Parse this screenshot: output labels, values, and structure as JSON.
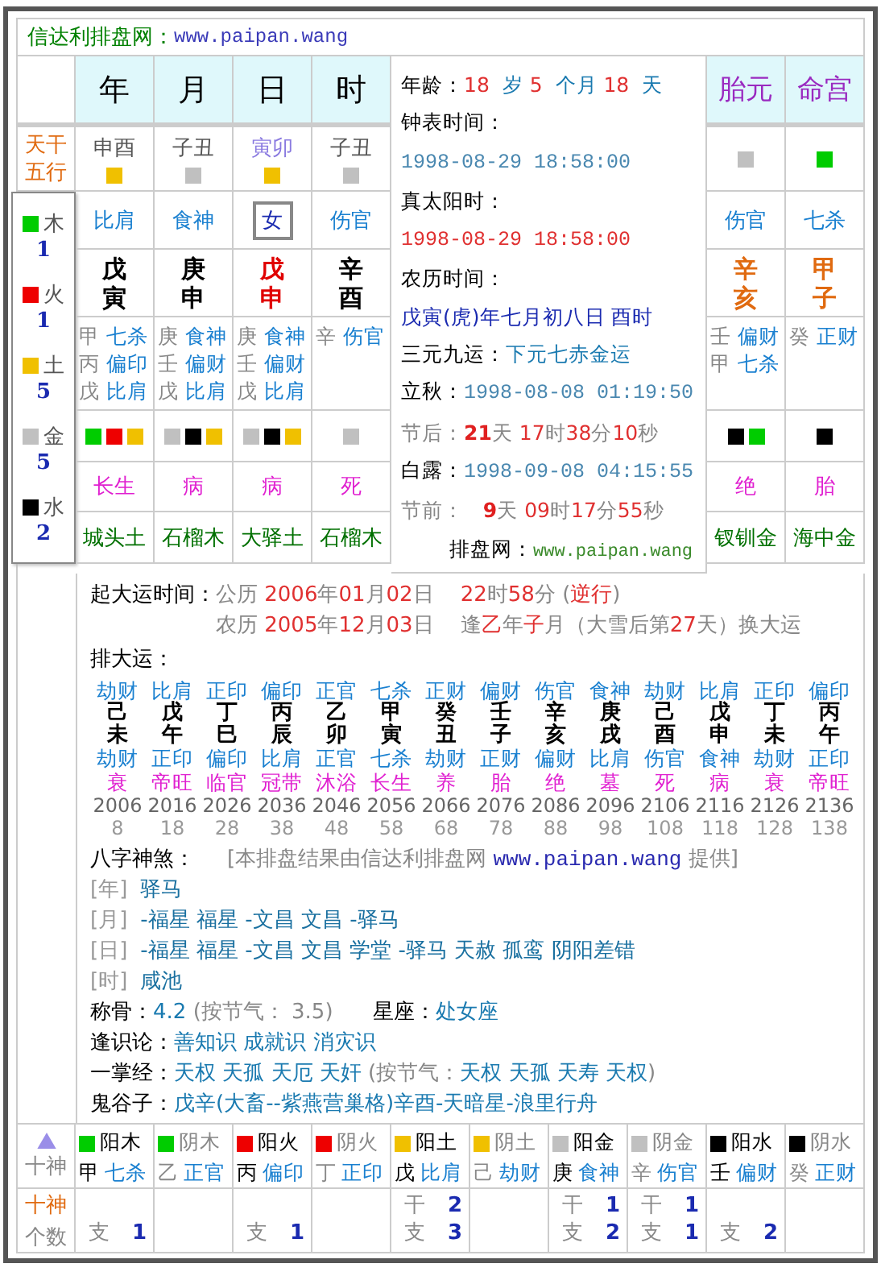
{
  "site": {
    "name": "信达利排盘网：",
    "url": "www.paipan.wang"
  },
  "row_label": "天干五行",
  "pillars": [
    {
      "title": "年",
      "void": "申酉",
      "highlight": false,
      "marks": [
        {
          "color": "#f0c000"
        }
      ],
      "god": {
        "kind": "god",
        "text": "比肩"
      },
      "stem": "戊",
      "branch": "寅",
      "hidden": [
        {
          "stem": "甲",
          "god": "七杀"
        },
        {
          "stem": "丙",
          "god": "偏印"
        },
        {
          "stem": "戊",
          "god": "比肩"
        }
      ],
      "elements": [
        {
          "color": "#00cc00"
        },
        {
          "color": "#ee0000"
        },
        {
          "color": "#f0c000"
        }
      ],
      "stage": "长生",
      "nayin": "城头土"
    },
    {
      "title": "月",
      "void": "子丑",
      "highlight": false,
      "marks": [
        {
          "color": "#c0c0c0"
        }
      ],
      "god": {
        "kind": "god",
        "text": "食神"
      },
      "stem": "庚",
      "branch": "申",
      "hidden": [
        {
          "stem": "庚",
          "god": "食神"
        },
        {
          "stem": "壬",
          "god": "偏财"
        },
        {
          "stem": "戊",
          "god": "比肩"
        }
      ],
      "elements": [
        {
          "color": "#c0c0c0"
        },
        {
          "color": "#000000"
        },
        {
          "color": "#f0c000"
        }
      ],
      "stage": "病",
      "nayin": "石榴木"
    },
    {
      "title": "日",
      "void": "寅卯",
      "highlight": true,
      "marks": [
        {
          "color": "#f0c000"
        }
      ],
      "god": {
        "kind": "gender",
        "text": "女"
      },
      "stem": "戊",
      "branch": "申",
      "hidden": [
        {
          "stem": "庚",
          "god": "食神"
        },
        {
          "stem": "壬",
          "god": "偏财"
        },
        {
          "stem": "戊",
          "god": "比肩"
        }
      ],
      "elements": [
        {
          "color": "#c0c0c0"
        },
        {
          "color": "#000000"
        },
        {
          "color": "#f0c000"
        }
      ],
      "stage": "病",
      "nayin": "大驿土"
    },
    {
      "title": "时",
      "void": "子丑",
      "highlight": false,
      "marks": [
        {
          "color": "#c0c0c0"
        }
      ],
      "god": {
        "kind": "god",
        "text": "伤官"
      },
      "stem": "辛",
      "branch": "酉",
      "hidden": [
        {
          "stem": "辛",
          "god": "伤官"
        }
      ],
      "elements": [
        {
          "color": "#c0c0c0"
        }
      ],
      "stage": "死",
      "nayin": "石榴木"
    }
  ],
  "extras": [
    {
      "title": "胎元",
      "marks": [
        {
          "color": "#c0c0c0"
        }
      ],
      "god": {
        "kind": "god",
        "text": "伤官"
      },
      "stem": "辛",
      "branch": "亥",
      "hidden": [
        {
          "stem": "壬",
          "god": "偏财"
        },
        {
          "stem": "甲",
          "god": "七杀"
        }
      ],
      "elements": [
        {
          "color": "#000000"
        },
        {
          "color": "#00cc00"
        }
      ],
      "stage": "绝",
      "nayin": "钗钏金"
    },
    {
      "title": "命宫",
      "marks": [
        {
          "color": "#00cc00"
        }
      ],
      "god": {
        "kind": "god",
        "text": "七杀"
      },
      "stem": "甲",
      "branch": "子",
      "hidden": [
        {
          "stem": "癸",
          "god": "正财"
        }
      ],
      "elements": [
        {
          "color": "#000000"
        }
      ],
      "stage": "胎",
      "nayin": "海中金"
    }
  ],
  "legend": [
    {
      "name": "木",
      "color": "#00cc00",
      "count": "1"
    },
    {
      "name": "火",
      "color": "#ee0000",
      "count": "1"
    },
    {
      "name": "土",
      "color": "#f0c000",
      "count": "5"
    },
    {
      "name": "金",
      "color": "#c0c0c0",
      "count": "5"
    },
    {
      "name": "水",
      "color": "#000000",
      "count": "2"
    }
  ],
  "info": {
    "lines": [
      [
        {
          "kind": "label",
          "text": "年龄："
        },
        {
          "kind": "num",
          "text": "18 "
        },
        {
          "kind": "value",
          "text": " 岁 "
        },
        {
          "kind": "num",
          "text": "5 "
        },
        {
          "kind": "value",
          "text": " 个月 "
        },
        {
          "kind": "num",
          "text": "18 "
        },
        {
          "kind": "value",
          "text": " 天"
        }
      ],
      [
        {
          "kind": "label",
          "text": "钟表时间："
        }
      ],
      [
        {
          "kind": "date",
          "text": "1998-08-29 18:58:00"
        }
      ],
      [
        {
          "kind": "label",
          "text": "真太阳时："
        }
      ],
      [
        {
          "kind": "date_red",
          "text": "1998-08-29 18:58:00"
        }
      ],
      [
        {
          "kind": "label",
          "text": "农历时间："
        }
      ],
      [
        {
          "kind": "lunar",
          "text": "戊寅(虎)年七月初八日 酉时"
        }
      ],
      [
        {
          "kind": "label",
          "text": "三元九运："
        },
        {
          "kind": "value",
          "text": "下元七赤金运"
        }
      ],
      [
        {
          "kind": "label",
          "text": "立秋："
        },
        {
          "kind": "date",
          "text": "1998-08-08 01:19:50"
        }
      ],
      [
        {
          "kind": "muted",
          "text": "节后："
        },
        {
          "kind": "num_bold",
          "text": "21"
        },
        {
          "kind": "muted",
          "text": "天 "
        },
        {
          "kind": "num",
          "text": "17"
        },
        {
          "kind": "muted",
          "text": "时"
        },
        {
          "kind": "num",
          "text": "38"
        },
        {
          "kind": "muted",
          "text": "分"
        },
        {
          "kind": "num",
          "text": "10"
        },
        {
          "kind": "muted",
          "text": "秒"
        }
      ],
      [
        {
          "kind": "label",
          "text": "白露："
        },
        {
          "kind": "date",
          "text": "1998-09-08 04:15:55"
        }
      ],
      [
        {
          "kind": "muted",
          "text": "节前：   "
        },
        {
          "kind": "num_bold",
          "text": "9"
        },
        {
          "kind": "muted",
          "text": "天 "
        },
        {
          "kind": "num",
          "text": "09"
        },
        {
          "kind": "muted",
          "text": "时"
        },
        {
          "kind": "num",
          "text": "17"
        },
        {
          "kind": "muted",
          "text": "分"
        },
        {
          "kind": "num",
          "text": "55"
        },
        {
          "kind": "muted",
          "text": "秒"
        }
      ]
    ],
    "footer": [
      {
        "kind": "label",
        "text": "排盘网："
      },
      {
        "kind": "link",
        "text": "www.paipan.wang"
      }
    ]
  },
  "qiyun": {
    "label": "起大运时间：",
    "lines": [
      [
        {
          "kind": "muted",
          "text": "公历 "
        },
        {
          "kind": "num",
          "text": "2006"
        },
        {
          "kind": "muted",
          "text": "年"
        },
        {
          "kind": "num",
          "text": "01"
        },
        {
          "kind": "muted",
          "text": "月"
        },
        {
          "kind": "num",
          "text": "02"
        },
        {
          "kind": "muted",
          "text": "日    "
        },
        {
          "kind": "num",
          "text": "22"
        },
        {
          "kind": "muted",
          "text": "时"
        },
        {
          "kind": "num",
          "text": "58"
        },
        {
          "kind": "muted",
          "text": "分 ("
        },
        {
          "kind": "num",
          "text": "逆行"
        },
        {
          "kind": "muted",
          "text": ")"
        }
      ],
      [
        {
          "kind": "muted",
          "text": "农历 "
        },
        {
          "kind": "num",
          "text": "2005"
        },
        {
          "kind": "muted",
          "text": "年"
        },
        {
          "kind": "num",
          "text": "12"
        },
        {
          "kind": "muted",
          "text": "月"
        },
        {
          "kind": "num",
          "text": "03"
        },
        {
          "kind": "muted",
          "text": "日    逢"
        },
        {
          "kind": "num",
          "text": "乙"
        },
        {
          "kind": "muted",
          "text": "年"
        },
        {
          "kind": "num",
          "text": "子"
        },
        {
          "kind": "muted",
          "text": "月（大雪后第"
        },
        {
          "kind": "num",
          "text": "27"
        },
        {
          "kind": "muted",
          "text": "天）换大运"
        }
      ]
    ]
  },
  "dayun": {
    "label": "排大运：",
    "columns": [
      {
        "god_top": "劫财",
        "stem": "己",
        "branch": "未",
        "god_bottom": "劫财",
        "stage": "衰",
        "year": "2006",
        "age": "8"
      },
      {
        "god_top": "比肩",
        "stem": "戊",
        "branch": "午",
        "god_bottom": "正印",
        "stage": "帝旺",
        "year": "2016",
        "age": "18"
      },
      {
        "god_top": "正印",
        "stem": "丁",
        "branch": "巳",
        "god_bottom": "偏印",
        "stage": "临官",
        "year": "2026",
        "age": "28"
      },
      {
        "god_top": "偏印",
        "stem": "丙",
        "branch": "辰",
        "god_bottom": "比肩",
        "stage": "冠带",
        "year": "2036",
        "age": "38"
      },
      {
        "god_top": "正官",
        "stem": "乙",
        "branch": "卯",
        "god_bottom": "正官",
        "stage": "沐浴",
        "year": "2046",
        "age": "48"
      },
      {
        "god_top": "七杀",
        "stem": "甲",
        "branch": "寅",
        "god_bottom": "七杀",
        "stage": "长生",
        "year": "2056",
        "age": "58"
      },
      {
        "god_top": "正财",
        "stem": "癸",
        "branch": "丑",
        "god_bottom": "劫财",
        "stage": "养",
        "year": "2066",
        "age": "68"
      },
      {
        "god_top": "偏财",
        "stem": "壬",
        "branch": "子",
        "god_bottom": "正财",
        "stage": "胎",
        "year": "2076",
        "age": "78"
      },
      {
        "god_top": "伤官",
        "stem": "辛",
        "branch": "亥",
        "god_bottom": "偏财",
        "stage": "绝",
        "year": "2086",
        "age": "88"
      },
      {
        "god_top": "食神",
        "stem": "庚",
        "branch": "戌",
        "god_bottom": "比肩",
        "stage": "墓",
        "year": "2096",
        "age": "98"
      },
      {
        "god_top": "劫财",
        "stem": "己",
        "branch": "酉",
        "god_bottom": "伤官",
        "stage": "死",
        "year": "2106",
        "age": "108"
      },
      {
        "god_top": "比肩",
        "stem": "戊",
        "branch": "申",
        "god_bottom": "食神",
        "stage": "病",
        "year": "2116",
        "age": "118"
      },
      {
        "god_top": "正印",
        "stem": "丁",
        "branch": "未",
        "god_bottom": "劫财",
        "stage": "衰",
        "year": "2126",
        "age": "128"
      },
      {
        "god_top": "偏印",
        "stem": "丙",
        "branch": "午",
        "god_bottom": "正印",
        "stage": "帝旺",
        "year": "2136",
        "age": "138"
      }
    ]
  },
  "shensha": {
    "label": "八字神煞：",
    "note": [
      {
        "kind": "muted",
        "text": "[本排盘结果由信达利排盘网 "
      },
      {
        "kind": "url",
        "text": "www.paipan.wang"
      },
      {
        "kind": "muted",
        "text": " 提供]"
      }
    ],
    "rows": [
      {
        "tag": "[年]",
        "text": "驿马"
      },
      {
        "tag": "[月]",
        "text": "-福星 福星 -文昌 文昌 -驿马"
      },
      {
        "tag": "[日]",
        "text": "-福星 福星 -文昌 文昌 学堂 -驿马 天赦 孤鸾 阴阳差错"
      },
      {
        "tag": "[时]",
        "text": "咸池"
      }
    ]
  },
  "details": [
    [
      {
        "kind": "label",
        "text": "称骨："
      },
      {
        "kind": "value",
        "text": "4.2"
      },
      {
        "kind": "muted",
        "text": " (按节气： 3.5)      "
      },
      {
        "kind": "label",
        "text": "星座："
      },
      {
        "kind": "value",
        "text": "处女座"
      }
    ],
    [
      {
        "kind": "label",
        "text": "逢识论："
      },
      {
        "kind": "value",
        "text": "善知识 成就识 消灾识"
      }
    ],
    [
      {
        "kind": "label",
        "text": "一掌经："
      },
      {
        "kind": "value",
        "text": "天权 天孤 天厄 天奸"
      },
      {
        "kind": "muted",
        "text": " (按节气："
      },
      {
        "kind": "value",
        "text": "天权 天孤 天寿 天权"
      },
      {
        "kind": "muted",
        "text": ")"
      }
    ],
    [
      {
        "kind": "label",
        "text": "鬼谷子："
      },
      {
        "kind": "value",
        "text": "戊辛(大畜--紫燕营巢格)辛酉-天暗星-浪里行舟"
      }
    ]
  ],
  "ten_gods": {
    "header": "十神",
    "count_label_top": "十神",
    "count_label_bottom": "个数",
    "columns": [
      {
        "element": "阳木",
        "color": "#00cc00",
        "yin": false,
        "stem": "甲",
        "god": "七杀",
        "counts": [
          {
            "label": "支",
            "value": "1"
          }
        ]
      },
      {
        "element": "阴木",
        "color": "#00cc00",
        "yin": true,
        "stem": "乙",
        "god": "正官"
      },
      {
        "element": "阳火",
        "color": "#ee0000",
        "yin": false,
        "stem": "丙",
        "god": "偏印",
        "counts": [
          {
            "label": "支",
            "value": "1"
          }
        ]
      },
      {
        "element": "阴火",
        "color": "#ee0000",
        "yin": true,
        "stem": "丁",
        "god": "正印"
      },
      {
        "element": "阳土",
        "color": "#f0c000",
        "yin": false,
        "stem": "戊",
        "god": "比肩",
        "counts": [
          {
            "label": "干",
            "value": "2"
          },
          {
            "label": "支",
            "value": "3"
          }
        ]
      },
      {
        "element": "阴土",
        "color": "#f0c000",
        "yin": true,
        "stem": "己",
        "god": "劫财"
      },
      {
        "element": "阳金",
        "color": "#c0c0c0",
        "yin": false,
        "stem": "庚",
        "god": "食神",
        "counts": [
          {
            "label": "干",
            "value": "1"
          },
          {
            "label": "支",
            "value": "2"
          }
        ]
      },
      {
        "element": "阴金",
        "color": "#c0c0c0",
        "yin": true,
        "stem": "辛",
        "god": "伤官",
        "counts": [
          {
            "label": "干",
            "value": "1"
          },
          {
            "label": "支",
            "value": "1"
          }
        ]
      },
      {
        "element": "阳水",
        "color": "#000000",
        "yin": false,
        "stem": "壬",
        "god": "偏财",
        "counts": [
          {
            "label": "支",
            "value": "2"
          }
        ]
      },
      {
        "element": "阴水",
        "color": "#000000",
        "yin": true,
        "stem": "癸",
        "god": "正财"
      }
    ]
  }
}
